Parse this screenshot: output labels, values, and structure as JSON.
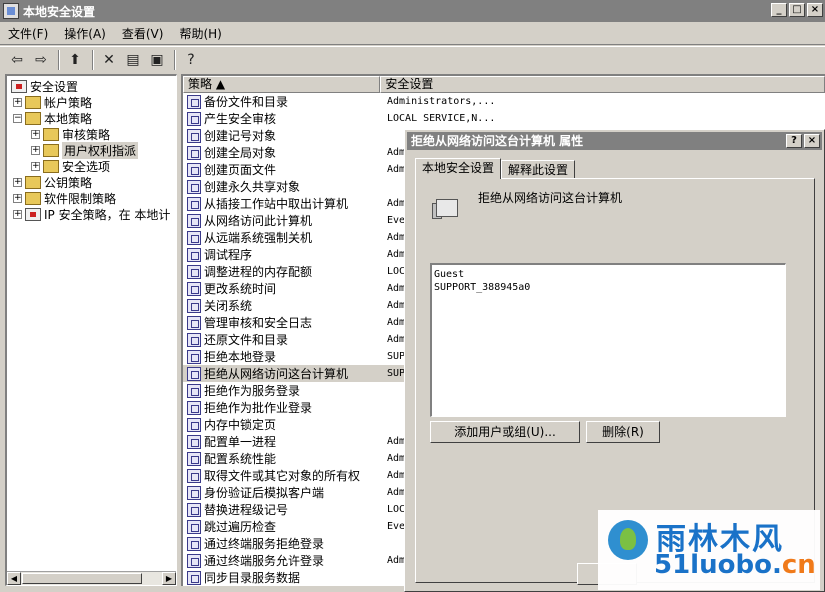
{
  "window": {
    "title": "本地安全设置"
  },
  "menu": [
    "文件(F)",
    "操作(A)",
    "查看(V)",
    "帮助(H)"
  ],
  "tree": {
    "root": "安全设置",
    "nodes": [
      {
        "label": "帐户策略"
      },
      {
        "label": "本地策略"
      },
      {
        "label": "审核策略"
      },
      {
        "label": "用户权利指派"
      },
      {
        "label": "安全选项"
      },
      {
        "label": "公钥策略"
      },
      {
        "label": "软件限制策略"
      },
      {
        "label": "IP 安全策略，在 本地计"
      }
    ]
  },
  "list": {
    "col_policy": "策略",
    "col_setting": "安全设置",
    "rows": [
      {
        "name": "备份文件和目录",
        "value": "Administrators,..."
      },
      {
        "name": "产生安全审核",
        "value": "LOCAL SERVICE,N..."
      },
      {
        "name": "创建记号对象",
        "value": ""
      },
      {
        "name": "创建全局对象",
        "value": "Adm"
      },
      {
        "name": "创建页面文件",
        "value": "Adm"
      },
      {
        "name": "创建永久共享对象",
        "value": ""
      },
      {
        "name": "从插接工作站中取出计算机",
        "value": "Adm"
      },
      {
        "name": "从网络访问此计算机",
        "value": "Eve"
      },
      {
        "name": "从远端系统强制关机",
        "value": "Adm"
      },
      {
        "name": "调试程序",
        "value": "Adm"
      },
      {
        "name": "调整进程的内存配额",
        "value": "LOC"
      },
      {
        "name": "更改系统时间",
        "value": "Adm"
      },
      {
        "name": "关闭系统",
        "value": "Adm"
      },
      {
        "name": "管理审核和安全日志",
        "value": "Adm"
      },
      {
        "name": "还原文件和目录",
        "value": "Adm"
      },
      {
        "name": "拒绝本地登录",
        "value": "SUP"
      },
      {
        "name": "拒绝从网络访问这台计算机",
        "value": "SUP"
      },
      {
        "name": "拒绝作为服务登录",
        "value": ""
      },
      {
        "name": "拒绝作为批作业登录",
        "value": ""
      },
      {
        "name": "内存中锁定页",
        "value": ""
      },
      {
        "name": "配置单一进程",
        "value": "Adm"
      },
      {
        "name": "配置系统性能",
        "value": "Adm"
      },
      {
        "name": "取得文件或其它对象的所有权",
        "value": "Adm"
      },
      {
        "name": "身份验证后模拟客户端",
        "value": "Adm"
      },
      {
        "name": "替换进程级记号",
        "value": "LOC"
      },
      {
        "name": "跳过遍历检查",
        "value": "Eve"
      },
      {
        "name": "通过终端服务拒绝登录",
        "value": ""
      },
      {
        "name": "通过终端服务允许登录",
        "value": "Adm"
      },
      {
        "name": "同步目录服务数据",
        "value": ""
      }
    ]
  },
  "dialog": {
    "title": "拒绝从网络访问这台计算机 属性",
    "tabs": [
      "本地安全设置",
      "解释此设置"
    ],
    "policy_name": "拒绝从网络访问这台计算机",
    "users": [
      "Guest",
      "SUPPORT_388945a0"
    ],
    "add_button": "添加用户或组(U)...",
    "remove_button": "删除(R)"
  },
  "watermark": {
    "cn": "雨林木风",
    "url_main": "51luobo.",
    "url_tld": "cn"
  }
}
